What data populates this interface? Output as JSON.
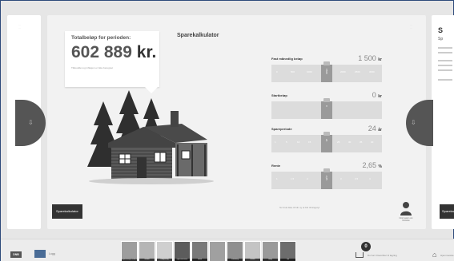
{
  "main": {
    "calc_title": "Sparekalkulator",
    "total": {
      "label": "Totalbeløp for perioden:",
      "amount": "602 889",
      "unit": "kr.",
      "note": "Tilskuddet og inflasjon er ikke beregnet"
    },
    "rows": [
      {
        "label": "Fast månedlig beløp",
        "value": "1 500",
        "unit": "kr",
        "ticks": [
          "0",
          "500",
          "1000",
          "1500",
          "2000",
          "2500",
          "3000"
        ],
        "knob_label": "1500",
        "knob_pos": 0.5
      },
      {
        "label": "Startbeløp",
        "value": "0",
        "unit": "kr",
        "ticks": [
          "",
          "",
          "",
          "",
          "",
          "",
          ""
        ],
        "knob_label": "0",
        "knob_pos": 0.5
      },
      {
        "label": "Spareperiode",
        "value": "24",
        "unit": "år",
        "ticks": [
          "1",
          "5",
          "10",
          "15",
          "20",
          "25",
          "30",
          "35",
          "40"
        ],
        "knob_label": "24",
        "knob_pos": 0.5
      },
      {
        "label": "Rente",
        "value": "2,65",
        "unit": "%",
        "ticks": [
          "1",
          "1,5",
          "2",
          "2,5",
          "3",
          "3,5",
          "4"
        ],
        "knob_label": "2,65",
        "knob_pos": 0.5
      }
    ],
    "bottom_note": "Sv bruk ikke til blir ny ai blir til Erigetyl",
    "calc_tab": "Sparekalkulator",
    "person_caption": "Informasjon om bibliotek"
  },
  "peek": {
    "title": "S",
    "sub": "Sp",
    "tab": "Sparekalkulator"
  },
  "bottom_bar": {
    "logo": "DNB",
    "book_label": "Logg",
    "thumb_labels": [
      "Miljøvennlig til Kommuner",
      "Studiet",
      "Rådgivning",
      "Sparekalkulator",
      "Helse",
      "",
      "Forsikring",
      "Finans",
      "Bolig",
      "Lån"
    ],
    "badge_count": "0",
    "box_label": "Du har 0 favoritter til lagring",
    "home_label": "Hjemmeside"
  },
  "colors": {
    "accent": "#2d4a7a",
    "dark": "#333333",
    "slider_track": "#dcdcdc",
    "slider_knob": "#9a9a9a"
  }
}
